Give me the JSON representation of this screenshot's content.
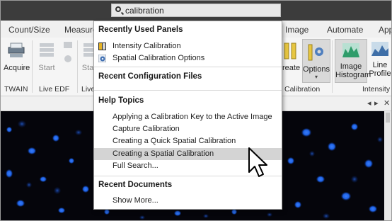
{
  "search": {
    "value": "calibration"
  },
  "tabs": [
    "Count/Size",
    "Measure",
    "Image",
    "Automate",
    "App"
  ],
  "ribbon": {
    "acquire": "Acquire",
    "start_left": "Start",
    "start_mid": "Sta",
    "create": "reate",
    "options": "Options",
    "image_histogram_l1": "Image",
    "image_histogram_l2": "Histogram",
    "line_profile_l1": "Line",
    "line_profile_l2": "Profile",
    "groups": {
      "twain": "TWAIN",
      "live_edf": "Live EDF",
      "live_partial": "Live",
      "calibration": "Calibration",
      "intensity": "Intensity"
    }
  },
  "docstrip": {
    "prev": "◂",
    "next": "▸",
    "close": "✕"
  },
  "dropdown": {
    "recently_used_panels": {
      "header": "Recently Used Panels",
      "items": [
        "Intensity Calibration",
        "Spatial Calibration Options"
      ]
    },
    "recent_configuration_files": {
      "header": "Recent Configuration Files"
    },
    "help_topics": {
      "header": "Help Topics",
      "items": [
        "Applying a Calibration Key to the Active Image",
        "Capture Calibration",
        "Creating a Quick Spatial Calibration",
        "Creating a Spatial Calibration",
        "Full Search..."
      ],
      "highlighted_item": "Creating a Spatial Calibration"
    },
    "recent_documents": {
      "header": "Recent Documents",
      "items": [
        "Show More..."
      ]
    }
  },
  "colors": {
    "title_bar": "#3c3c3c",
    "highlight": "#d4d4d4",
    "cell_stain": "#1d63e8",
    "image_bg": "#05050b"
  }
}
